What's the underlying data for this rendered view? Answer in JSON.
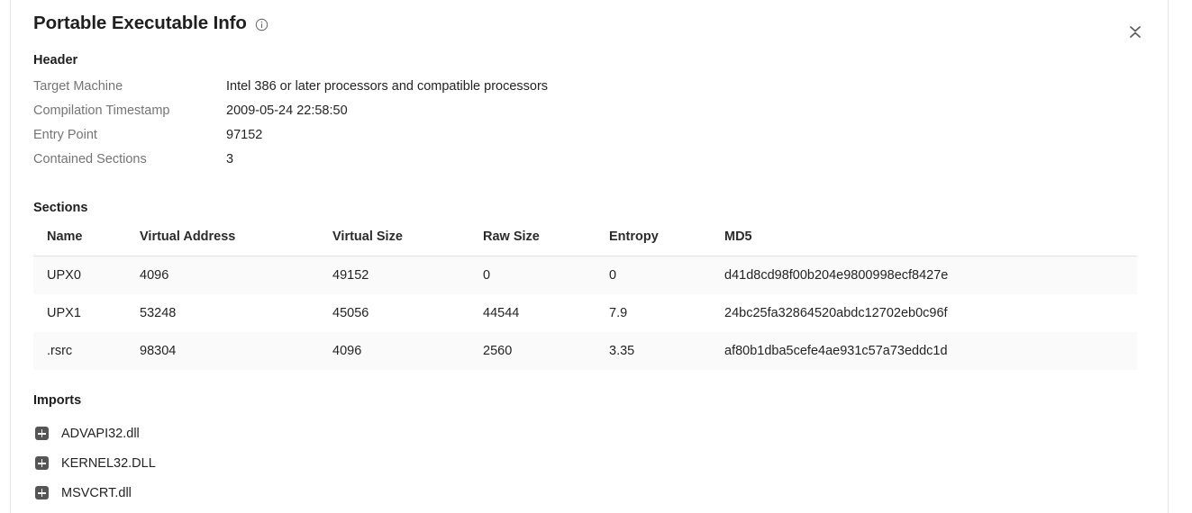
{
  "panel": {
    "title": "Portable Executable Info",
    "info_icon": "info-icon",
    "collapse_icon": "collapse-icon"
  },
  "header": {
    "heading": "Header",
    "rows": [
      {
        "label": "Target Machine",
        "value": "Intel 386 or later processors and compatible processors"
      },
      {
        "label": "Compilation Timestamp",
        "value": "2009-05-24 22:58:50"
      },
      {
        "label": "Entry Point",
        "value": "97152"
      },
      {
        "label": "Contained Sections",
        "value": "3"
      }
    ]
  },
  "sections": {
    "heading": "Sections",
    "columns": [
      "Name",
      "Virtual Address",
      "Virtual Size",
      "Raw Size",
      "Entropy",
      "MD5"
    ],
    "rows": [
      {
        "name": "UPX0",
        "virtual_address": "4096",
        "virtual_size": "49152",
        "raw_size": "0",
        "entropy": "0",
        "md5": "d41d8cd98f00b204e9800998ecf8427e"
      },
      {
        "name": "UPX1",
        "virtual_address": "53248",
        "virtual_size": "45056",
        "raw_size": "44544",
        "entropy": "7.9",
        "md5": "24bc25fa32864520abdc12702eb0c96f"
      },
      {
        "name": ".rsrc",
        "virtual_address": "98304",
        "virtual_size": "4096",
        "raw_size": "2560",
        "entropy": "3.35",
        "md5": "af80b1dba5cefe4ae931c57a73eddc1d"
      }
    ]
  },
  "imports": {
    "heading": "Imports",
    "items": [
      {
        "name": "ADVAPI32.dll",
        "expand_icon": "plus-icon"
      },
      {
        "name": "KERNEL32.DLL",
        "expand_icon": "plus-icon"
      },
      {
        "name": "MSVCRT.dll",
        "expand_icon": "plus-icon"
      }
    ]
  },
  "colors": {
    "label": "#757575",
    "value": "#242424",
    "stripe": "#fafafa",
    "border": "#e2e2e2",
    "icon_bg": "#555555"
  }
}
